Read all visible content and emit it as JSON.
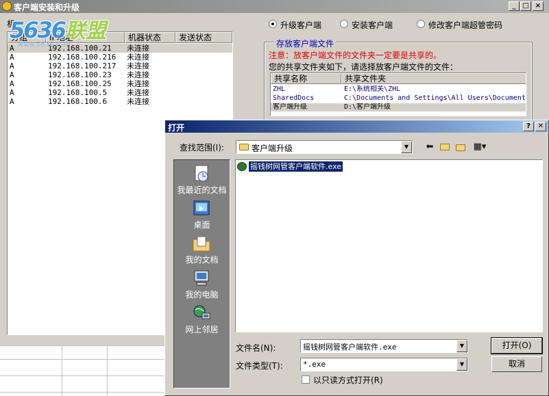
{
  "main_window": {
    "title": "客户端安装和升级",
    "watermark_number": "5636",
    "watermark_text": "联盟",
    "watermark_url": "www.5636.com",
    "machine_label": "机"
  },
  "machine_list": {
    "columns": [
      "分组",
      "IP地址",
      "机器状态",
      "发送状态"
    ],
    "rows": [
      {
        "group": "A",
        "ip": "192.168.100.21",
        "state": "未连接",
        "send": ""
      },
      {
        "group": "A",
        "ip": "192.168.100.216",
        "state": "未连接",
        "send": ""
      },
      {
        "group": "A",
        "ip": "192.168.100.217",
        "state": "未连接",
        "send": ""
      },
      {
        "group": "A",
        "ip": "192.168.100.23",
        "state": "未连接",
        "send": ""
      },
      {
        "group": "A",
        "ip": "192.168.100.25",
        "state": "未连接",
        "send": ""
      },
      {
        "group": "A",
        "ip": "192.168.100.5",
        "state": "未连接",
        "send": ""
      },
      {
        "group": "A",
        "ip": "192.168.100.6",
        "state": "未连接",
        "send": ""
      }
    ]
  },
  "mode_options": [
    {
      "label": "升级客户端",
      "selected": true
    },
    {
      "label": "安装客户端",
      "selected": false
    },
    {
      "label": "修改客户端超管密码",
      "selected": false
    }
  ],
  "share_group": {
    "title": "存放客户端文件",
    "notice": "注意：放客户端文件的文件夹一定要是共享的。",
    "hint": "您的共享文件夹如下，请选择放客户端文件的文件：",
    "columns": [
      "共享名称",
      "共享文件夹"
    ],
    "rows": [
      {
        "name": "ZHL",
        "path": "E:\\系统相关\\ZHL"
      },
      {
        "name": "SharedDocs",
        "path": "C:\\Documents and Settings\\All Users\\Documents"
      },
      {
        "name": "客户端升级",
        "path": "D:\\客户端升级"
      }
    ]
  },
  "dialog": {
    "title": "打开",
    "help_button": "?",
    "close_button": "✕",
    "look_in_label": "查找范围(I):",
    "look_in_value": "客户端升级",
    "places": [
      "我最近的文档",
      "桌面",
      "我的文档",
      "我的电脑",
      "网上邻居"
    ],
    "files": [
      "摇钱树网管客户端软件.exe"
    ],
    "filename_label": "文件名(N):",
    "filename_value": "摇钱树网管客户端软件.exe",
    "filetype_label": "文件类型(T):",
    "filetype_value": "*.exe",
    "readonly_label": "以只读方式打开(R)",
    "open_button": "打开(O)",
    "cancel_button": "取消"
  },
  "colors": {
    "titlebar_active": "#0a246a",
    "titlebar_inactive": "#808080",
    "notice_red": "#e00000",
    "group_title_blue": "#0000c0"
  }
}
